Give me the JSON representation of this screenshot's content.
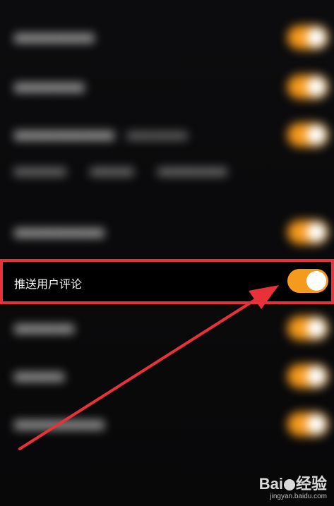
{
  "blurred_rows": [
    {
      "label": "■■■■■■■■",
      "sub": "",
      "toggle": true
    },
    {
      "label": "■■■■■■■",
      "sub": "",
      "toggle": true
    },
    {
      "label": "■■■■■■■■■■",
      "sub": "■■■■■■■",
      "toggle": true
    },
    {
      "label": "■■■■■■■■■",
      "sub": "",
      "toggle": true
    },
    {
      "label": "■■■■■■",
      "sub": "",
      "toggle": true
    },
    {
      "label": "■■■■■",
      "sub": "",
      "toggle": true
    },
    {
      "label": "■■■■■■■■■",
      "sub": "",
      "toggle": true
    }
  ],
  "blurred_desc": [
    "■■■■■■",
    "■■■■■",
    "■■■■■■■■"
  ],
  "highlighted_setting": {
    "label": "推送用户评论",
    "enabled": true
  },
  "colors": {
    "toggle_on": "#f59a1c",
    "highlight_border": "#e8323a",
    "arrow": "#e8323a"
  },
  "watermark": {
    "brand_left": "Bai",
    "brand_right": "经验",
    "url": "jingyan.baidu.com"
  }
}
